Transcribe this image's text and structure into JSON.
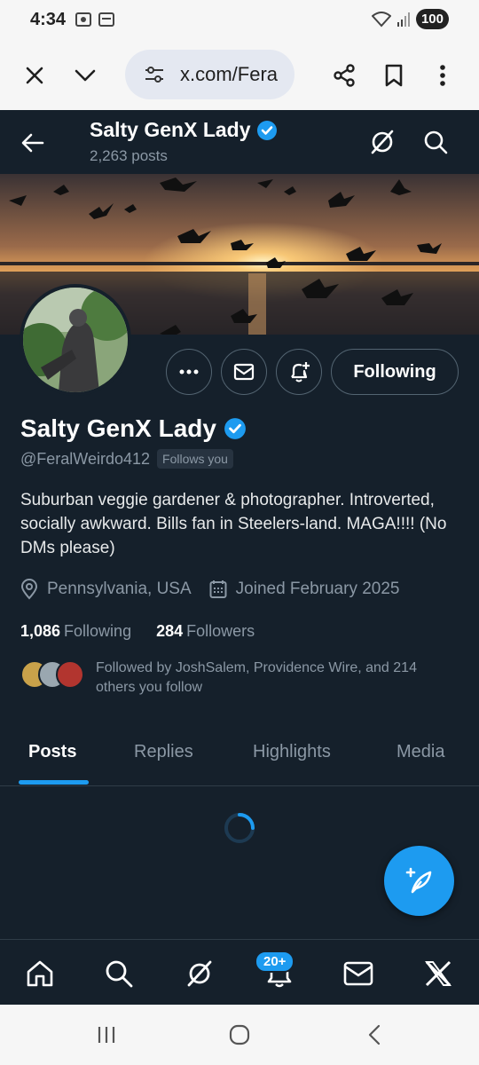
{
  "status_bar": {
    "time": "4:34",
    "battery": "100"
  },
  "browser": {
    "url": "x.com/Fera"
  },
  "profile": {
    "header_name": "Salty GenX Lady",
    "post_count": "2,263 posts",
    "name": "Salty GenX Lady",
    "handle": "@FeralWeirdo412",
    "follows_you_badge": "Follows you",
    "bio": "Suburban veggie gardener & photographer. Introverted, socially awkward. Bills fan in Steelers-land. MAGA!!!! (No DMs please)",
    "location": "Pennsylvania, USA",
    "joined": "Joined February 2025",
    "following_count": "1,086",
    "following_label": "Following",
    "followers_count": "284",
    "followers_label": "Followers",
    "followed_by": "Followed by JoshSalem, Providence Wire, and 214 others you follow",
    "following_button": "Following"
  },
  "tabs": [
    "Posts",
    "Replies",
    "Highlights",
    "Media"
  ],
  "notifications_badge": "20+",
  "colors": {
    "background": "#15202b",
    "accent": "#1d9bf0",
    "secondary_text": "#8b98a5",
    "border": "#536471"
  }
}
